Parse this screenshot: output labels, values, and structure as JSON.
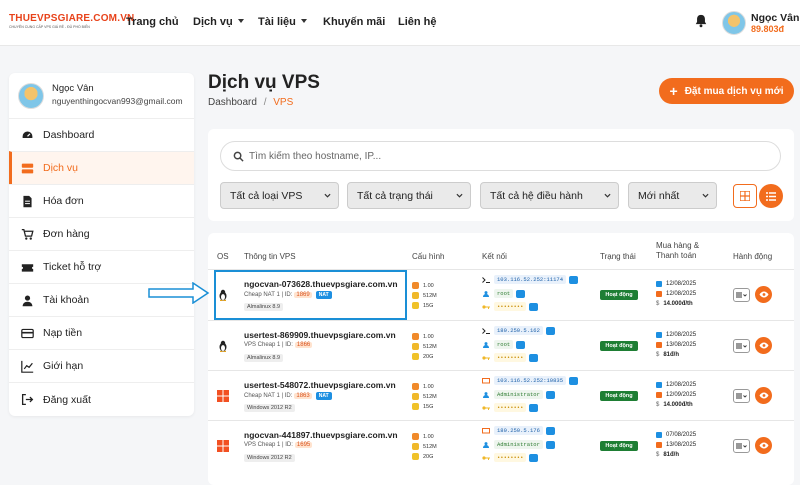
{
  "brand": {
    "name": "THUEVPSGIARE.COM.VN",
    "tagline": "CHUYÊN CUNG CẤP VPS GIÁ RẺ - ĐỦ PHỔ BIẾN"
  },
  "nav": {
    "home": "Trang chủ",
    "services": "Dịch vụ",
    "docs": "Tài liệu",
    "promo": "Khuyến mãi",
    "contact": "Liên hệ"
  },
  "user": {
    "name": "Ngọc Vân",
    "balance": "89.803đ",
    "email": "nguyenthingocvan993@gmail.com"
  },
  "sidebar": {
    "items": [
      {
        "label": "Dashboard",
        "icon": "speedometer-icon"
      },
      {
        "label": "Dịch vụ",
        "icon": "server-icon"
      },
      {
        "label": "Hóa đơn",
        "icon": "invoice-icon"
      },
      {
        "label": "Đơn hàng",
        "icon": "cart-icon"
      },
      {
        "label": "Ticket hỗ trợ",
        "icon": "ticket-icon"
      },
      {
        "label": "Tài khoản",
        "icon": "user-icon"
      },
      {
        "label": "Nạp tiền",
        "icon": "card-icon"
      },
      {
        "label": "Giới hạn",
        "icon": "chart-line-icon"
      },
      {
        "label": "Đăng xuất",
        "icon": "logout-icon"
      }
    ]
  },
  "page": {
    "title": "Dịch vụ VPS",
    "crumb_home": "Dashboard",
    "crumb_sep": "/",
    "crumb_current": "VPS",
    "order_button": "Đặt mua dịch vụ mới"
  },
  "filters": {
    "search_placeholder": "Tìm kiếm theo hostname, IP...",
    "type": "Tất cả loại VPS",
    "status": "Tất cả trạng thái",
    "os": "Tất cả hệ điều hành",
    "sort": "Mới nhất"
  },
  "table": {
    "headers": {
      "os": "OS",
      "info": "Thông tin VPS",
      "config": "Cấu hình",
      "conn": "Kết nối",
      "status": "Trạng thái",
      "billing1": "Mua hàng &",
      "billing2": "Thanh toán",
      "action": "Hành động"
    },
    "rows": [
      {
        "os": "linux",
        "hostname": "ngocvan-073628.thuevpsgiare.com.vn",
        "plan": "Cheap NAT 1 | ID:",
        "id": "1869",
        "nat": "NAT",
        "osname": "Almalinux 8.9",
        "cpu": "1.00",
        "ram": "512M",
        "disk": "15G",
        "ip": "103.116.52.252:11174",
        "userlabel": "root",
        "pass": "••••••••",
        "status": "Hoạt động",
        "buy": "12/08/2025",
        "due": "12/08/2025",
        "price": "14.000đ/th"
      },
      {
        "os": "linux",
        "hostname": "usertest-869909.thuevpsgiare.com.vn",
        "plan": "VPS Cheap 1 | ID:",
        "id": "1866",
        "nat": "",
        "osname": "Almalinux 8.9",
        "cpu": "1.00",
        "ram": "512M",
        "disk": "20G",
        "ip": "180.250.5.162",
        "userlabel": "root",
        "pass": "••••••••",
        "status": "Hoạt động",
        "buy": "12/08/2025",
        "due": "13/08/2025",
        "price": "81đ/h"
      },
      {
        "os": "windows",
        "hostname": "usertest-548072.thuevpsgiare.com.vn",
        "plan": "Cheap NAT 1 | ID:",
        "id": "1863",
        "nat": "NAT",
        "osname": "Windows 2012 R2",
        "cpu": "1.00",
        "ram": "512M",
        "disk": "15G",
        "ip": "103.116.52.252:10835",
        "userlabel": "Administrator",
        "pass": "••••••••",
        "status": "Hoạt động",
        "buy": "12/08/2025",
        "due": "12/09/2025",
        "price": "14.000đ/th"
      },
      {
        "os": "windows",
        "hostname": "ngocvan-441897.thuevpsgiare.com.vn",
        "plan": "VPS Cheap 1 | ID:",
        "id": "1695",
        "nat": "",
        "osname": "Windows 2012 R2",
        "cpu": "1.00",
        "ram": "512M",
        "disk": "20G",
        "ip": "180.250.5.176",
        "userlabel": "Administrator",
        "pass": "••••••••",
        "status": "Hoạt động",
        "buy": "07/08/2025",
        "due": "13/08/2025",
        "price": "81đ/h"
      }
    ]
  },
  "colors": {
    "accent": "#f26c1d",
    "status": "#1e7e34",
    "highlight": "#1a8fd6"
  }
}
